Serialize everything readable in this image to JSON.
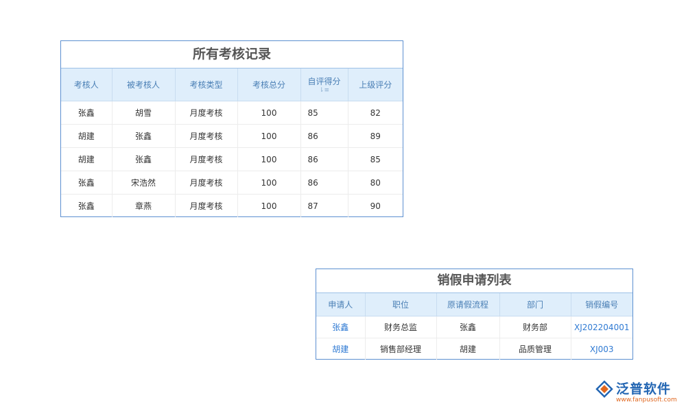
{
  "review_table": {
    "title": "所有考核记录",
    "headers": [
      "考核人",
      "被考核人",
      "考核类型",
      "考核总分",
      "自评得分",
      "上级评分"
    ],
    "rows": [
      [
        "张鑫",
        "胡雪",
        "月度考核",
        "100",
        "85",
        "82"
      ],
      [
        "胡建",
        "张鑫",
        "月度考核",
        "100",
        "86",
        "89"
      ],
      [
        "胡建",
        "张鑫",
        "月度考核",
        "100",
        "86",
        "85"
      ],
      [
        "张鑫",
        "宋浩然",
        "月度考核",
        "100",
        "86",
        "80"
      ],
      [
        "张鑫",
        "章燕",
        "月度考核",
        "100",
        "87",
        "90"
      ]
    ]
  },
  "leave_cancel_table": {
    "title": "销假申请列表",
    "headers": [
      "申请人",
      "职位",
      "原请假流程",
      "部门",
      "销假编号"
    ],
    "rows": [
      [
        "张鑫",
        "财务总监",
        "张鑫",
        "财务部",
        "XJ202204001"
      ],
      [
        "胡建",
        "销售部经理",
        "胡建",
        "品质管理",
        "XJ003"
      ]
    ]
  },
  "logo": {
    "brand": "泛普软件",
    "url": "www.fanpusoft.com",
    "icon": "fanpu-logo-icon"
  }
}
